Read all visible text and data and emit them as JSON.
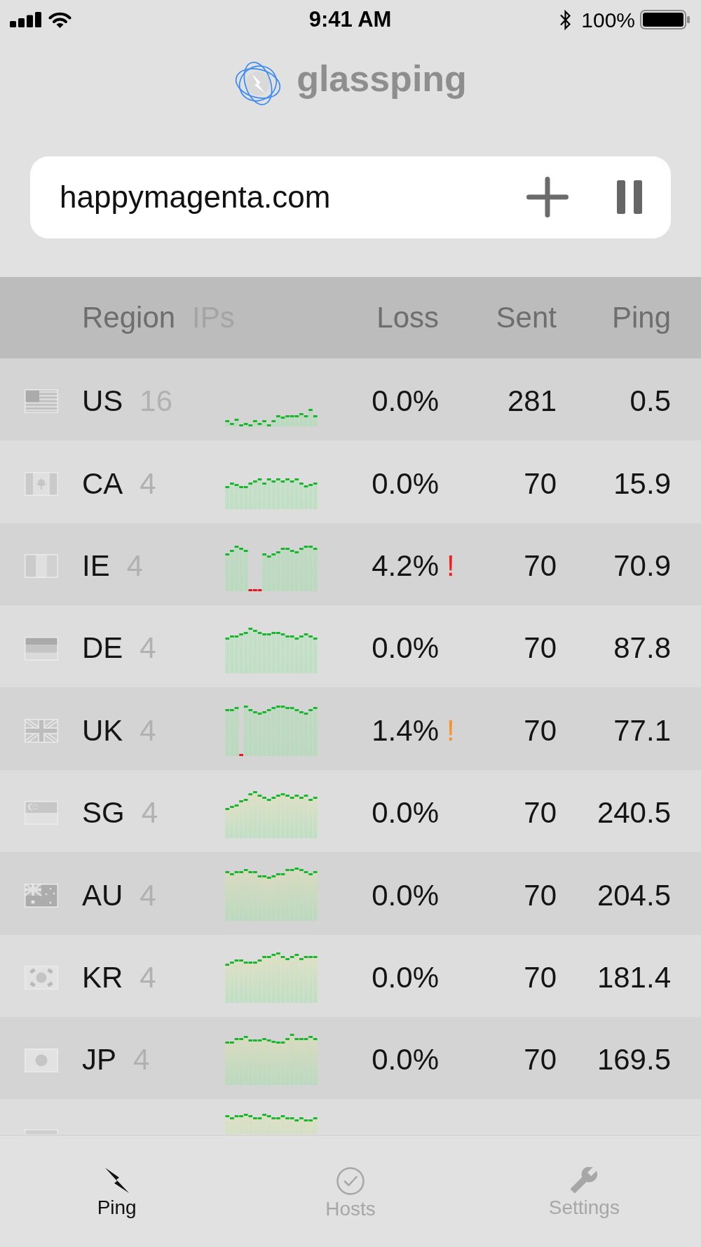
{
  "status_bar": {
    "time": "9:41 AM",
    "battery": "100%"
  },
  "header": {
    "title": "glassping"
  },
  "host_field": {
    "value": "happymagenta.com"
  },
  "table": {
    "columns": {
      "region": "Region",
      "ips": "IPs",
      "loss": "Loss",
      "sent": "Sent",
      "ping": "Ping"
    },
    "rows": [
      {
        "flag": {
          "kind": "us"
        },
        "region": "US",
        "ips": "16",
        "loss": "0.0%",
        "sent": "281",
        "ping": "0.5",
        "partial": false
      },
      {
        "flag": {
          "kind": "ca"
        },
        "region": "CA",
        "ips": "4",
        "loss": "0.0%",
        "sent": "70",
        "ping": "15.9",
        "partial": false
      },
      {
        "flag": {
          "kind": "ie"
        },
        "region": "IE",
        "ips": "4",
        "loss": "4.2%",
        "alert": {
          "text": "!",
          "color": "#f21f1f"
        },
        "sent": "70",
        "ping": "70.9",
        "partial": false
      },
      {
        "flag": {
          "kind": "de"
        },
        "region": "DE",
        "ips": "4",
        "loss": "0.0%",
        "sent": "70",
        "ping": "87.8",
        "partial": false
      },
      {
        "flag": {
          "kind": "uk"
        },
        "region": "UK",
        "ips": "4",
        "loss": "1.4%",
        "alert": {
          "text": "!",
          "color": "#f7922c"
        },
        "sent": "70",
        "ping": "77.1",
        "partial": false
      },
      {
        "flag": {
          "kind": "sg"
        },
        "region": "SG",
        "ips": "4",
        "loss": "0.0%",
        "sent": "70",
        "ping": "240.5",
        "partial": false
      },
      {
        "flag": {
          "kind": "au"
        },
        "region": "AU",
        "ips": "4",
        "loss": "0.0%",
        "sent": "70",
        "ping": "204.5",
        "partial": false
      },
      {
        "flag": {
          "kind": "kr"
        },
        "region": "KR",
        "ips": "4",
        "loss": "0.0%",
        "sent": "70",
        "ping": "181.4",
        "partial": false
      },
      {
        "flag": {
          "kind": "jp"
        },
        "region": "JP",
        "ips": "4",
        "loss": "0.0%",
        "sent": "70",
        "ping": "169.5",
        "partial": false
      },
      {
        "flag": {
          "kind": "in"
        },
        "partial": true
      }
    ]
  },
  "tab_bar": {
    "tabs": [
      {
        "label": "Ping",
        "selected": true
      },
      {
        "label": "Hosts",
        "selected": false
      },
      {
        "label": "Settings",
        "selected": false
      }
    ]
  }
}
